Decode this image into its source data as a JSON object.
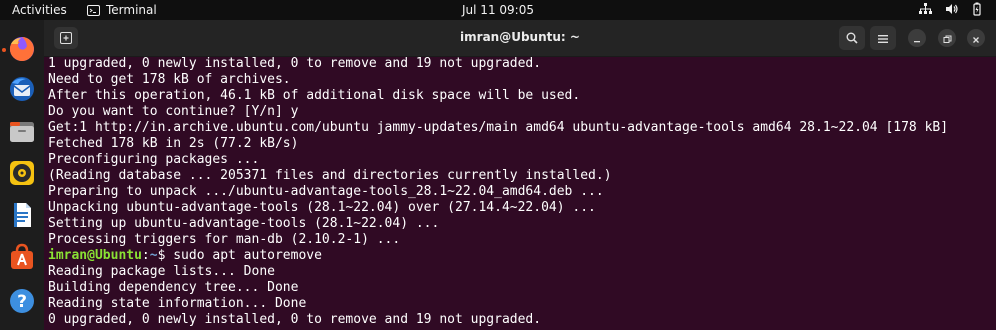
{
  "topbar": {
    "activities": "Activities",
    "app_name": "Terminal",
    "clock": "Jul 11  09:05"
  },
  "dock": {
    "items": [
      {
        "name": "Firefox",
        "icon": "firefox-icon",
        "color": "#ff7139"
      },
      {
        "name": "Thunderbird",
        "icon": "thunderbird-icon",
        "color": "#2a77d1"
      },
      {
        "name": "Files",
        "icon": "files-icon",
        "color": "#d0d0d0"
      },
      {
        "name": "Rhythmbox",
        "icon": "rhythmbox-icon",
        "color": "#f5c211"
      },
      {
        "name": "LibreOffice Writer",
        "icon": "writer-icon",
        "color": "#3a8fd8"
      },
      {
        "name": "Ubuntu Software",
        "icon": "software-icon",
        "color": "#e95420"
      },
      {
        "name": "Help",
        "icon": "help-icon",
        "color": "#3d8fe0"
      }
    ]
  },
  "window": {
    "title": "imran@Ubuntu: ~"
  },
  "terminal": {
    "lines": [
      "1 upgraded, 0 newly installed, 0 to remove and 19 not upgraded.",
      "Need to get 178 kB of archives.",
      "After this operation, 46.1 kB of additional disk space will be used.",
      "Do you want to continue? [Y/n] y",
      "Get:1 http://in.archive.ubuntu.com/ubuntu jammy-updates/main amd64 ubuntu-advantage-tools amd64 28.1~22.04 [178 kB]",
      "Fetched 178 kB in 2s (77.2 kB/s)",
      "Preconfiguring packages ...",
      "(Reading database ... 205371 files and directories currently installed.)",
      "Preparing to unpack .../ubuntu-advantage-tools_28.1~22.04_amd64.deb ...",
      "Unpacking ubuntu-advantage-tools (28.1~22.04) over (27.14.4~22.04) ...",
      "Setting up ubuntu-advantage-tools (28.1~22.04) ...",
      "Processing triggers for man-db (2.10.2-1) ..."
    ],
    "prompt": {
      "user_host": "imran@Ubuntu",
      "sep": ":",
      "path": "~",
      "symbol": "$",
      "command": " sudo apt autoremove"
    },
    "after_lines": [
      "Reading package lists... Done",
      "Building dependency tree... Done",
      "Reading state information... Done",
      "0 upgraded, 0 newly installed, 0 to remove and 19 not upgraded."
    ]
  },
  "colors": {
    "terminal_bg": "#300a24",
    "prompt_user": "#8ae234",
    "prompt_path": "#729fcf",
    "accent": "#e95420"
  }
}
